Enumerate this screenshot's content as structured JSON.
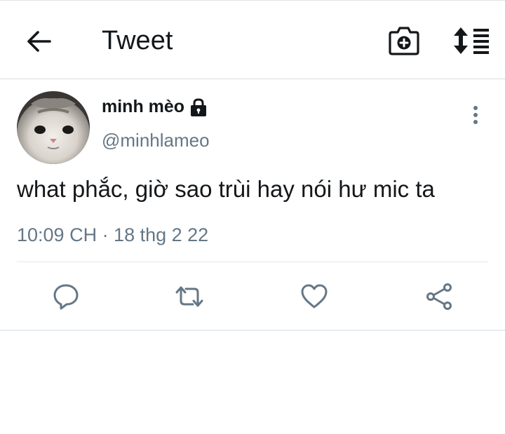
{
  "header": {
    "title": "Tweet",
    "icons": [
      "arrow-left-icon",
      "camera-plus-icon",
      "sort-list-icon"
    ]
  },
  "tweet": {
    "author": {
      "display_name": "minh mèo",
      "handle": "@minhlameo",
      "protected": true
    },
    "text": "what phắc, giờ sao trùi hay nói hư mic ta",
    "timestamp": "10:09 CH · 18 thg 2 22",
    "actions": [
      "reply",
      "retweet",
      "like",
      "share"
    ]
  },
  "colors": {
    "text_primary": "#14171a",
    "text_secondary": "#657786",
    "icon_action": "#657786",
    "divider": "#e1e8ed"
  }
}
